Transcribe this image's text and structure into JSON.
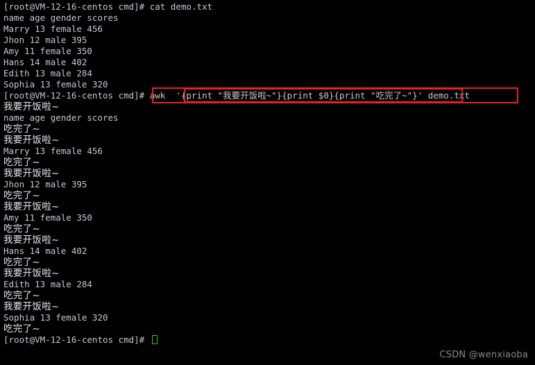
{
  "terminal": {
    "prompt": "[root@VM-12-16-centos cmd]# ",
    "hostname": "VM-12-16-centos",
    "user": "root",
    "cwd": "cmd",
    "colors": {
      "background": "#000000",
      "ascii_text": "#c8c8d0",
      "cjk_text": "#e8e8ee",
      "cursor": "#1fd11f",
      "highlight_box": "#ee2020",
      "watermark": "#8a8a8a"
    },
    "lines": [
      {
        "type": "prompt",
        "text": "[root@VM-12-16-centos cmd]# cat demo.txt"
      },
      {
        "type": "ascii",
        "text": "name age gender scores"
      },
      {
        "type": "ascii",
        "text": "Marry 13 female 456"
      },
      {
        "type": "ascii",
        "text": "Jhon 12 male 395"
      },
      {
        "type": "ascii",
        "text": "Amy 11 female 350"
      },
      {
        "type": "ascii",
        "text": "Hans 14 male 402"
      },
      {
        "type": "ascii",
        "text": "Edith 13 male 284"
      },
      {
        "type": "ascii",
        "text": "Sophia 13 female 320"
      },
      {
        "type": "prompt",
        "text": "[root@VM-12-16-centos cmd]# awk  '{print \"我要开饭啦~\"}{print $0}{print \"吃完了~\"}' demo.txt"
      },
      {
        "type": "cjk",
        "text": "我要开饭啦~"
      },
      {
        "type": "ascii",
        "text": "name age gender scores"
      },
      {
        "type": "cjk",
        "text": "吃完了~"
      },
      {
        "type": "cjk",
        "text": "我要开饭啦~"
      },
      {
        "type": "ascii",
        "text": "Marry 13 female 456"
      },
      {
        "type": "cjk",
        "text": "吃完了~"
      },
      {
        "type": "cjk",
        "text": "我要开饭啦~"
      },
      {
        "type": "ascii",
        "text": "Jhon 12 male 395"
      },
      {
        "type": "cjk",
        "text": "吃完了~"
      },
      {
        "type": "cjk",
        "text": "我要开饭啦~"
      },
      {
        "type": "ascii",
        "text": "Amy 11 female 350"
      },
      {
        "type": "cjk",
        "text": "吃完了~"
      },
      {
        "type": "cjk",
        "text": "我要开饭啦~"
      },
      {
        "type": "ascii",
        "text": "Hans 14 male 402"
      },
      {
        "type": "cjk",
        "text": "吃完了~"
      },
      {
        "type": "cjk",
        "text": "我要开饭啦~"
      },
      {
        "type": "ascii",
        "text": "Edith 13 male 284"
      },
      {
        "type": "cjk",
        "text": "吃完了~"
      },
      {
        "type": "cjk",
        "text": "我要开饭啦~"
      },
      {
        "type": "ascii",
        "text": "Sophia 13 female 320"
      },
      {
        "type": "cjk",
        "text": "吃完了~"
      },
      {
        "type": "prompt-cursor",
        "text": "[root@VM-12-16-centos cmd]# "
      }
    ],
    "annotations": {
      "outer_box_label": "awk  '{print \"我要开饭啦~\"}{print $0}{print \"吃完了~\"}' demo.txt",
      "inner_box_label": "'{print \"我要开饭啦~\"}{print $0}{print \"吃完了~\"}'"
    }
  },
  "watermark": {
    "text": "CSDN @wenxiaoba"
  }
}
